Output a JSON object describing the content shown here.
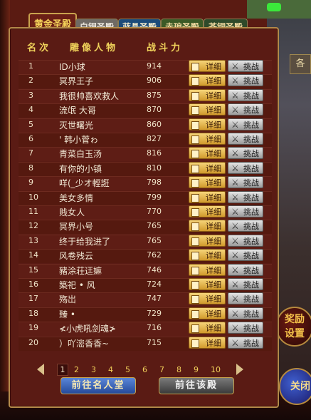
{
  "tabs": [
    {
      "label": "黄金圣殿",
      "active": true
    },
    {
      "label": "白银圣殿"
    },
    {
      "label": "蓝晶圣殿"
    },
    {
      "label": "赤琅圣殿"
    },
    {
      "label": "苍铜圣殿"
    }
  ],
  "headers": {
    "rank": "名次",
    "name": "雕像人物",
    "power": "战斗力"
  },
  "buttons": {
    "detail": "详细",
    "challenge": "挑战"
  },
  "rows": [
    {
      "rank": "1",
      "name": "ID小球",
      "power": "914"
    },
    {
      "rank": "2",
      "name": "冥界王子",
      "power": "906"
    },
    {
      "rank": "3",
      "name": "我很帅喜欢救人",
      "power": "875"
    },
    {
      "rank": "4",
      "name": "流氓 大哥",
      "power": "870"
    },
    {
      "rank": "5",
      "name": "灭世曙光",
      "power": "860"
    },
    {
      "rank": "6",
      "name": "' 韩小菅ゎ",
      "power": "827"
    },
    {
      "rank": "7",
      "name": "青菜白玉汤",
      "power": "816"
    },
    {
      "rank": "8",
      "name": "有你的小镇",
      "power": "810"
    },
    {
      "rank": "9",
      "name": "咩(_少オ輕誑",
      "power": "798"
    },
    {
      "rank": "10",
      "name": "美女多情",
      "power": "799"
    },
    {
      "rank": "11",
      "name": "贱女人",
      "power": "770"
    },
    {
      "rank": "12",
      "name": "冥界小号",
      "power": "765"
    },
    {
      "rank": "13",
      "name": "终于给我进了",
      "power": "765"
    },
    {
      "rank": "14",
      "name": "风卷残云",
      "power": "762"
    },
    {
      "rank": "15",
      "name": "豬涂荘迋嫲",
      "power": "746"
    },
    {
      "rank": "16",
      "name": "築祀 • 风",
      "power": "724"
    },
    {
      "rank": "17",
      "name": "殇岀",
      "power": "747"
    },
    {
      "rank": "18",
      "name": "臻 •",
      "power": "729"
    },
    {
      "rank": "19",
      "name": "≮小虎吼剑魂≯",
      "power": "716"
    },
    {
      "rank": "20",
      "name": "）吖滵香香~",
      "power": "715"
    }
  ],
  "pagination": {
    "pages": [
      "1",
      "2",
      "3",
      "4",
      "5",
      "6",
      "7",
      "8",
      "9",
      "10"
    ],
    "current": "1"
  },
  "bottom_buttons": {
    "hall": "前往名人堂",
    "goto": "前往该殿"
  },
  "side": {
    "reward_line1": "奖励",
    "reward_line2": "设置",
    "orb_label": "关闭",
    "tab_hint": "各"
  },
  "colors": {
    "accent_gold": "#f0d35b",
    "panel_bg": "#5a1b14",
    "border": "#b48a4a"
  }
}
